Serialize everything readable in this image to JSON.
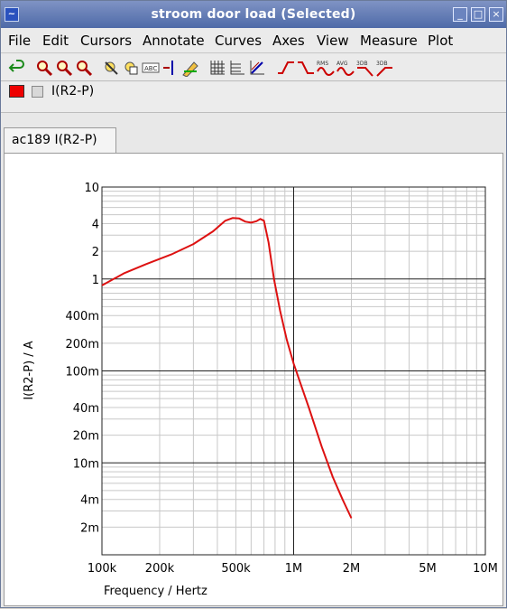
{
  "window": {
    "title": "stroom door load (Selected)"
  },
  "menu": [
    "File",
    "Edit",
    "Cursors",
    "Annotate",
    "Curves",
    "Axes",
    "View",
    "Measure",
    "Plot"
  ],
  "toolbar": {
    "icons": [
      "undo-icon",
      "zoom-in-icon",
      "zoom-out-icon",
      "zoom-fit-icon",
      "select-icon",
      "pan-icon",
      "label-icon",
      "add-cursor-icon",
      "curve-edit-icon",
      "grid-icon",
      "axis-icon",
      "axis-alt-icon",
      "rising-edge-icon",
      "falling-edge-icon",
      "rms-icon",
      "avg-icon",
      "3db-icon",
      "3db-alt-icon"
    ],
    "rms_label": "RMS",
    "avg_label": "AVG",
    "db_label_1": "3DB",
    "db_label_2": "3DB"
  },
  "legend": {
    "label": "I(R2-P)",
    "color": "#ee0000"
  },
  "tab": {
    "label": "ac189 I(R2-P)"
  },
  "chart_data": {
    "type": "line",
    "xscale": "log",
    "yscale": "log",
    "xlabel": "Frequency / Hertz",
    "ylabel": "I(R2-P) / A",
    "xlim": [
      100000,
      10000000
    ],
    "ylim": [
      0.001,
      10
    ],
    "xticks": [
      {
        "v": 100000,
        "t": "100k"
      },
      {
        "v": 200000,
        "t": "200k"
      },
      {
        "v": 500000,
        "t": "500k"
      },
      {
        "v": 1000000,
        "t": "1M"
      },
      {
        "v": 2000000,
        "t": "2M"
      },
      {
        "v": 5000000,
        "t": "5M"
      },
      {
        "v": 10000000,
        "t": "10M"
      }
    ],
    "yticks": [
      {
        "v": 10,
        "t": "10"
      },
      {
        "v": 4,
        "t": "4"
      },
      {
        "v": 2,
        "t": "2"
      },
      {
        "v": 1,
        "t": "1"
      },
      {
        "v": 0.4,
        "t": "400m"
      },
      {
        "v": 0.2,
        "t": "200m"
      },
      {
        "v": 0.1,
        "t": "100m"
      },
      {
        "v": 0.04,
        "t": "40m"
      },
      {
        "v": 0.02,
        "t": "20m"
      },
      {
        "v": 0.01,
        "t": "10m"
      },
      {
        "v": 0.004,
        "t": "4m"
      },
      {
        "v": 0.002,
        "t": "2m"
      }
    ],
    "grid": true,
    "series": [
      {
        "color": "#dd1111",
        "points": [
          [
            100000,
            0.85
          ],
          [
            130000,
            1.15
          ],
          [
            170000,
            1.45
          ],
          [
            230000,
            1.85
          ],
          [
            300000,
            2.4
          ],
          [
            380000,
            3.3
          ],
          [
            440000,
            4.3
          ],
          [
            480000,
            4.6
          ],
          [
            520000,
            4.55
          ],
          [
            560000,
            4.2
          ],
          [
            600000,
            4.1
          ],
          [
            640000,
            4.25
          ],
          [
            670000,
            4.5
          ],
          [
            700000,
            4.3
          ],
          [
            740000,
            2.5
          ],
          [
            790000,
            1.0
          ],
          [
            850000,
            0.45
          ],
          [
            920000,
            0.22
          ],
          [
            1000000,
            0.12
          ],
          [
            1200000,
            0.04
          ],
          [
            1400000,
            0.015
          ],
          [
            1600000,
            0.007
          ],
          [
            1800000,
            0.004
          ],
          [
            2000000,
            0.0025
          ]
        ]
      }
    ]
  }
}
